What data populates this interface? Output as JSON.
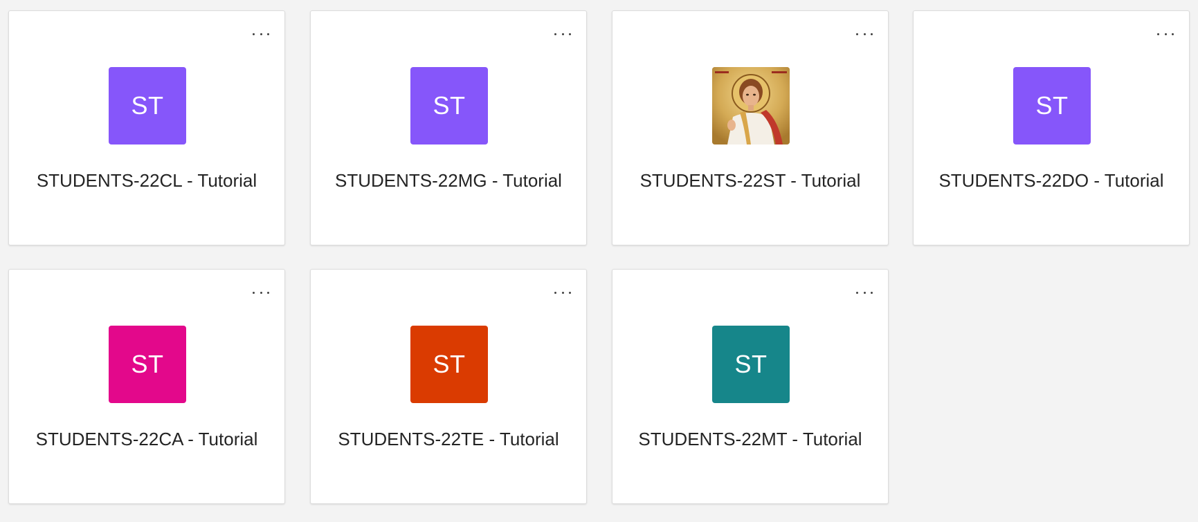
{
  "teams": [
    {
      "name": "STUDENTS-22CL - Tutorial",
      "initials": "ST",
      "color": "#8656fa",
      "avatar": "initials"
    },
    {
      "name": "STUDENTS-22MG - Tutorial",
      "initials": "ST",
      "color": "#8656fa",
      "avatar": "initials"
    },
    {
      "name": "STUDENTS-22ST - Tutorial",
      "initials": "",
      "color": "#c9a24a",
      "avatar": "icon-image"
    },
    {
      "name": "STUDENTS-22DO - Tutorial",
      "initials": "ST",
      "color": "#8656fa",
      "avatar": "initials"
    },
    {
      "name": "STUDENTS-22CA - Tutorial",
      "initials": "ST",
      "color": "#e3088b",
      "avatar": "initials"
    },
    {
      "name": "STUDENTS-22TE - Tutorial",
      "initials": "ST",
      "color": "#da3b01",
      "avatar": "initials"
    },
    {
      "name": "STUDENTS-22MT - Tutorial",
      "initials": "ST",
      "color": "#16868a",
      "avatar": "initials"
    }
  ],
  "icons": {
    "more": "more-options-icon",
    "saint_image": "saint-icon-image"
  }
}
